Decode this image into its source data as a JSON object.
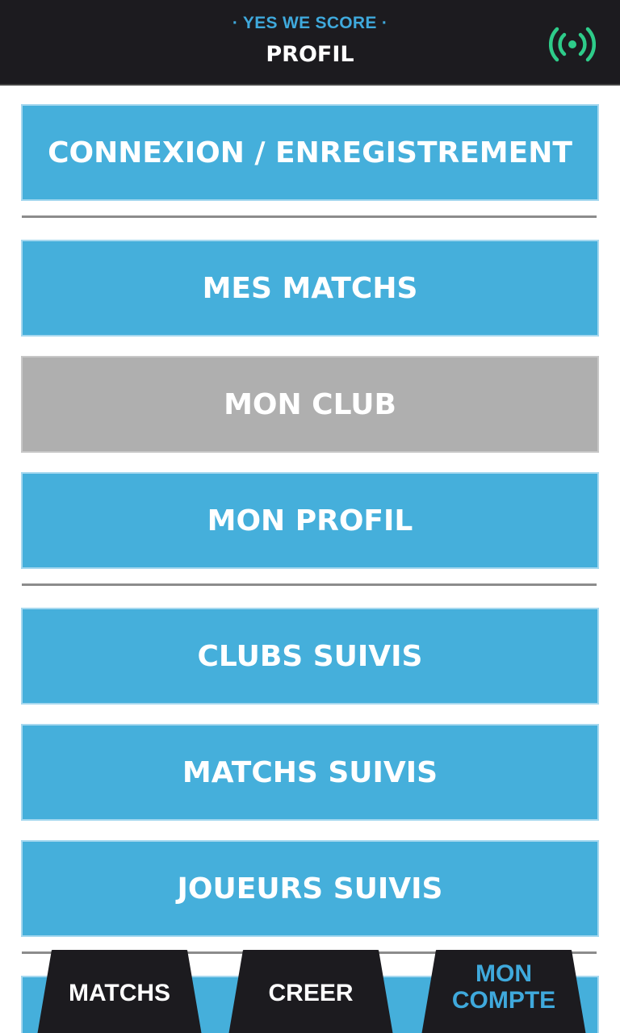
{
  "header": {
    "brand": "· YES WE SCORE ·",
    "title": "PROFIL",
    "live_icon": "broadcast-icon",
    "live_icon_color": "#2ecc8a"
  },
  "menu": {
    "login_register": "CONNEXION / ENREGISTREMENT",
    "my_matches": "MES MATCHS",
    "my_club": "MON CLUB",
    "my_profile": "MON PROFIL",
    "followed_clubs": "CLUBS SUIVIS",
    "followed_matches": "MATCHS SUIVIS",
    "followed_players": "JOUEURS SUIVIS"
  },
  "tabs": {
    "matchs": "MATCHS",
    "creer": "CREER",
    "mon": "MON",
    "compte": "COMPTE"
  },
  "colors": {
    "button_blue": "#45afdb",
    "button_grey": "#afafaf",
    "header_bg": "#1c1b1f",
    "brand_blue": "#3fa9dc",
    "active_tab_text": "#3fa9dc"
  }
}
